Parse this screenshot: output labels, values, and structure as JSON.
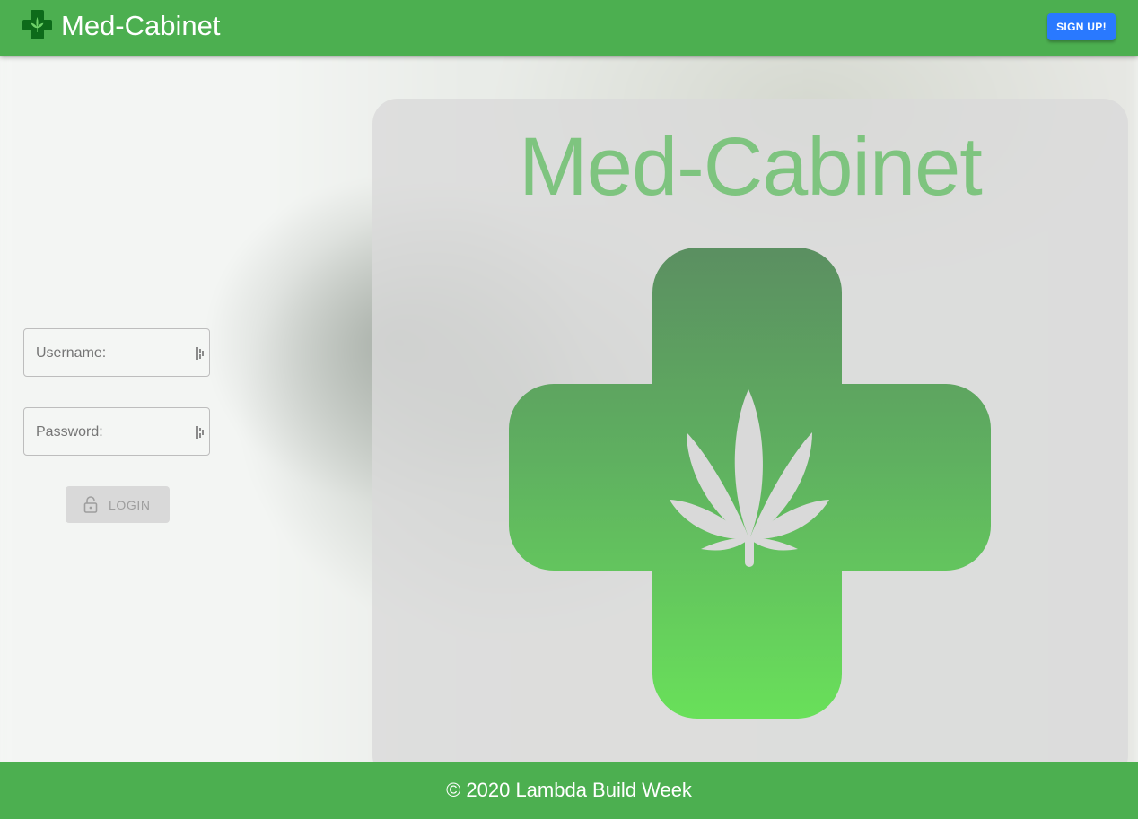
{
  "header": {
    "title": "Med-Cabinet",
    "signup_label": "SIGN UP!"
  },
  "login_form": {
    "username_placeholder": "Username:",
    "password_placeholder": "Password:",
    "login_label": "LOGIN"
  },
  "hero": {
    "title": "Med-Cabinet"
  },
  "footer": {
    "copyright": "© 2020 Lambda Build Week"
  },
  "colors": {
    "header_green": "#4caf50",
    "signup_blue": "#2979ff",
    "hero_title_green": "#7ec47f",
    "cross_top_green": "#5b8f61",
    "cross_bottom_green": "#69e05a"
  },
  "icons": {
    "logo": "medical-cross-leaf-icon",
    "field_icon": "password-manager-key-icon",
    "login_icon": "lock-open-icon"
  }
}
